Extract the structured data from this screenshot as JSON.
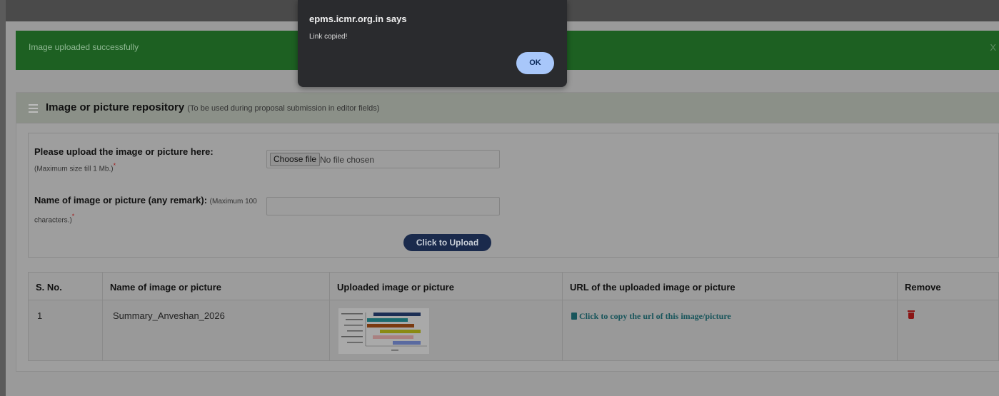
{
  "dialog": {
    "title": "epms.icmr.org.in says",
    "message": "Link copied!",
    "ok_label": "OK"
  },
  "alert": {
    "message": "Image uploaded successfully",
    "close": "X"
  },
  "panel": {
    "title": "Image or picture repository",
    "subtitle": "(To be used during proposal submission in editor fields)"
  },
  "form": {
    "upload_label": "Please upload the image or picture here:",
    "upload_hint": "(Maximum size till 1 Mb.)",
    "required_mark": "*",
    "choose_file": "Choose file",
    "no_file": "No file chosen",
    "name_label": "Name of image or picture (any remark):",
    "name_hint": "(Maximum 100 characters.)",
    "name_value": "",
    "upload_button": "Click to Upload"
  },
  "table": {
    "headers": [
      "S. No.",
      "Name of image or picture",
      "Uploaded image or picture",
      "URL of the uploaded image or picture",
      "Remove"
    ],
    "rows": [
      {
        "sno": "1",
        "name": "Summary_Anveshan_2026",
        "url_link": "Click to copy the url of this image/picture"
      }
    ]
  },
  "icons": {
    "menu": "hamburger-icon",
    "clipboard": "clipboard-icon",
    "remove": "trash-icon"
  },
  "colors": {
    "alert_bg": "#1d6022",
    "button_bg": "#1a2a4c",
    "dialog_bg": "#2a2b2e",
    "ok_bg": "#a8c7fa",
    "remove": "#8a1414"
  }
}
